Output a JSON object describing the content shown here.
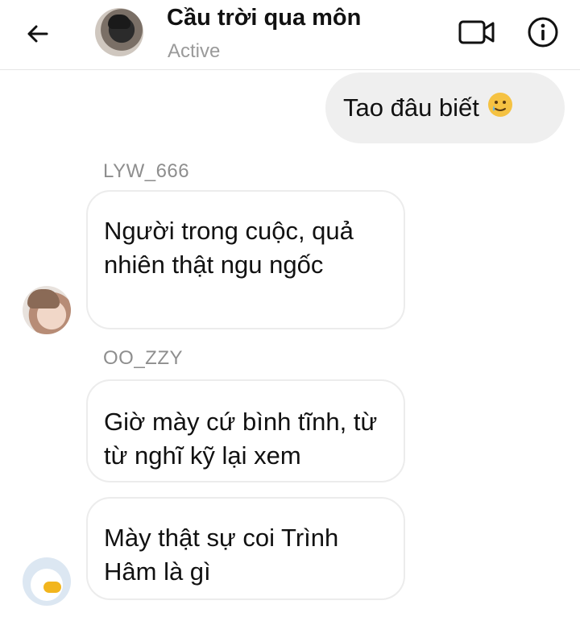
{
  "header": {
    "title": "Cầu trời qua môn",
    "status": "Active",
    "back_icon": "arrow-left-icon",
    "video_icon": "video-camera-icon",
    "info_icon": "info-icon"
  },
  "messages": [
    {
      "direction": "outgoing",
      "text": "Tao đâu biết",
      "emoji_icon": "smiling-face-with-tear-icon"
    },
    {
      "direction": "incoming",
      "sender": "LYW_666",
      "text": "Người trong cuộc, quả nhiên thật ngu ngốc"
    },
    {
      "direction": "incoming",
      "sender": "OO_ZZY",
      "text": "Giờ mày cứ bình tĩnh, từ từ nghĩ kỹ lại xem"
    },
    {
      "direction": "incoming",
      "text": "Mày thật sự coi Trình Hâm là gì"
    }
  ],
  "colors": {
    "outgoing_bubble": "#efefef",
    "incoming_border": "#ececec",
    "muted_text": "#9a9a9a"
  }
}
